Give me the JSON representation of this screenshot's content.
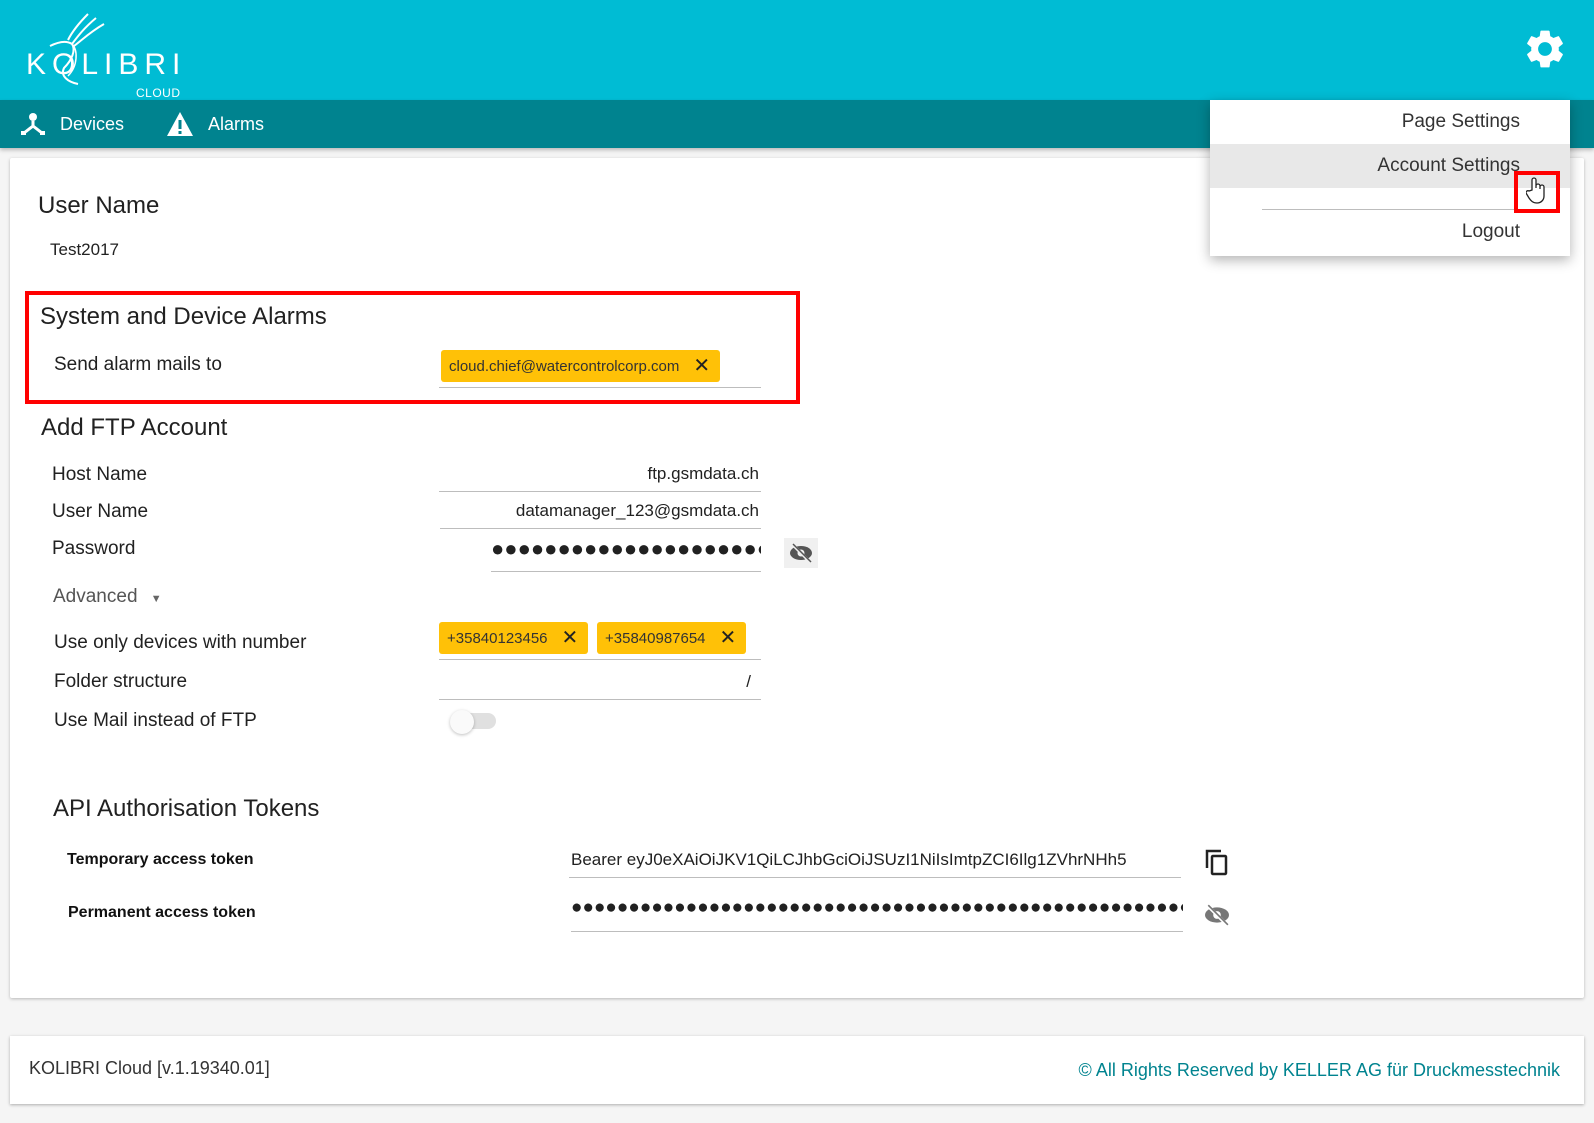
{
  "app": {
    "logo_text": "KOLIBRI",
    "logo_sub": "CLOUD",
    "accent_color": "#00bcd4",
    "nav_color": "#00838f",
    "chip_color": "#ffc107"
  },
  "nav": {
    "items": [
      {
        "label": "Devices",
        "icon": "devices-icon"
      },
      {
        "label": "Alarms",
        "icon": "warning-icon"
      }
    ]
  },
  "settings_menu": {
    "icon": "gear-icon",
    "items": [
      {
        "label": "Page Settings",
        "active": false
      },
      {
        "label": "Account Settings",
        "active": true
      },
      {
        "label": "Logout",
        "active": false
      }
    ]
  },
  "user": {
    "heading": "User Name",
    "value": "Test2017"
  },
  "alarms": {
    "heading": "System and Device Alarms",
    "send_label": "Send alarm mails to",
    "emails": [
      "cloud.chief@watercontrolcorp.com"
    ]
  },
  "ftp": {
    "heading": "Add FTP Account",
    "host_label": "Host Name",
    "host_value": "ftp.gsmdata.ch",
    "user_label": "User Name",
    "user_value": "datamanager_123@gsmdata.ch",
    "password_label": "Password",
    "password_value": "●●●●●●●●●●●●●●●●●●●●●●●",
    "advanced_label": "Advanced",
    "devices_label": "Use only devices with number",
    "device_numbers": [
      "+35840123456",
      "+35840987654"
    ],
    "folder_label": "Folder structure",
    "folder_value": "/",
    "mail_toggle_label": "Use Mail instead of FTP",
    "mail_toggle_on": false
  },
  "api": {
    "heading": "API Authorisation Tokens",
    "temp_label": "Temporary access token",
    "temp_value": "Bearer eyJ0eXAiOiJKV1QiLCJhbGciOiJSUzI1NiIsImtpZCI6Ilg1ZVhrNHh5",
    "perm_label": "Permanent access token",
    "perm_value": "●●●●●●●●●●●●●●●●●●●●●●●●●●●●●●●●●●●●●●●●●●●●●●●●●●●●●●●"
  },
  "footer": {
    "version": "KOLIBRI Cloud [v.1.19340.01]",
    "copyright": "© All Rights Reserved by KELLER AG für Druckmesstechnik"
  }
}
